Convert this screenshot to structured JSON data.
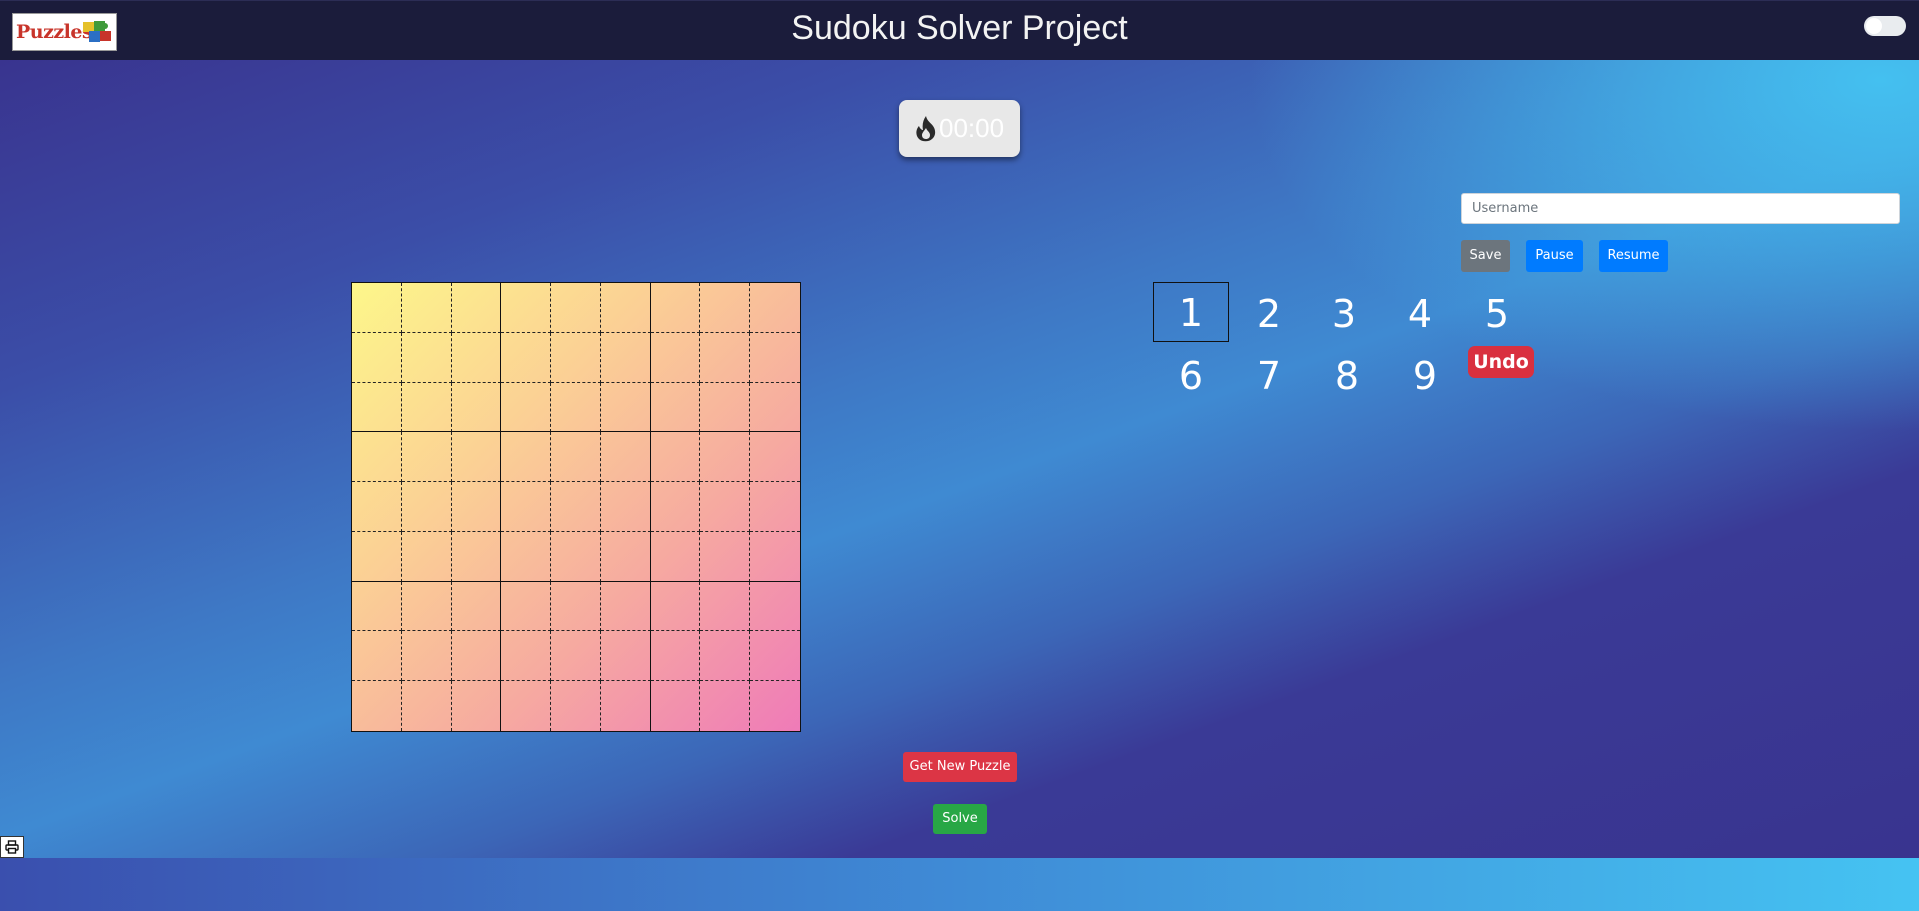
{
  "navbar": {
    "logo_text": "Puzzles",
    "title": "Sudoku Solver Project",
    "theme_toggle": "off"
  },
  "timer": {
    "icon": "fire-icon",
    "value": "00:00"
  },
  "board": {
    "size": 9,
    "cells": [
      [
        "",
        "",
        "",
        "",
        "",
        "",
        "",
        "",
        ""
      ],
      [
        "",
        "",
        "",
        "",
        "",
        "",
        "",
        "",
        ""
      ],
      [
        "",
        "",
        "",
        "",
        "",
        "",
        "",
        "",
        ""
      ],
      [
        "",
        "",
        "",
        "",
        "",
        "",
        "",
        "",
        ""
      ],
      [
        "",
        "",
        "",
        "",
        "",
        "",
        "",
        "",
        ""
      ],
      [
        "",
        "",
        "",
        "",
        "",
        "",
        "",
        "",
        ""
      ],
      [
        "",
        "",
        "",
        "",
        "",
        "",
        "",
        "",
        ""
      ],
      [
        "",
        "",
        "",
        "",
        "",
        "",
        "",
        "",
        ""
      ],
      [
        "",
        "",
        "",
        "",
        "",
        "",
        "",
        "",
        ""
      ]
    ]
  },
  "controls": {
    "username_placeholder": "Username",
    "username_value": "",
    "save_label": "Save",
    "pause_label": "Pause",
    "resume_label": "Resume"
  },
  "numpad": {
    "numbers": [
      "1",
      "2",
      "3",
      "4",
      "5",
      "6",
      "7",
      "8",
      "9"
    ],
    "selected": "1",
    "undo_label": "Undo"
  },
  "actions": {
    "new_puzzle_label": "Get New Puzzle",
    "solve_label": "Solve"
  },
  "footer": {
    "print_icon": "printer-icon"
  },
  "colors": {
    "navbar": "#1b1c3b",
    "accent_blue": "#007bff",
    "danger_red": "#dc3545",
    "success_green": "#28a745",
    "secondary_gray": "#6c757d"
  }
}
